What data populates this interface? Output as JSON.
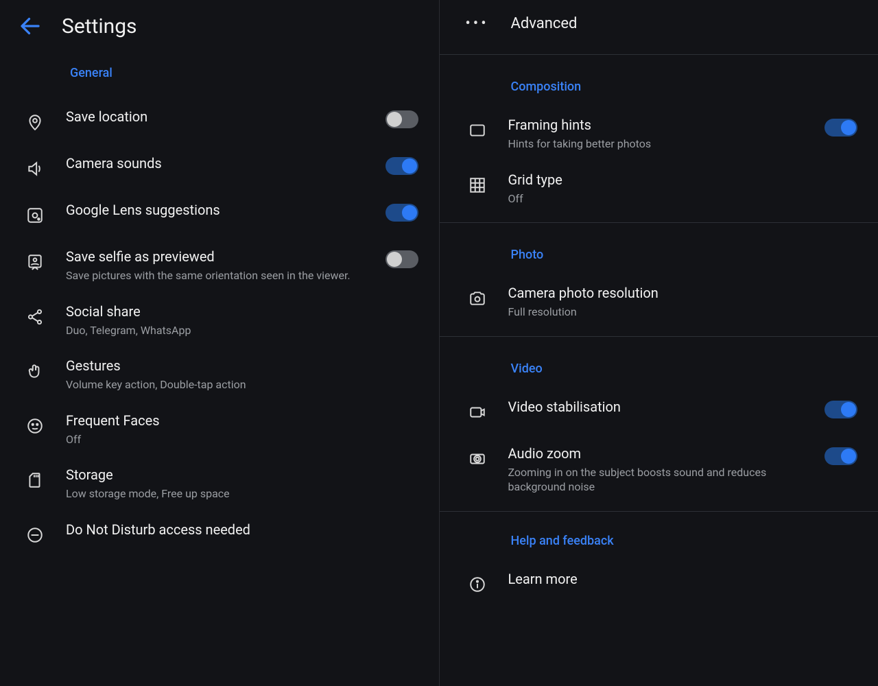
{
  "left": {
    "title": "Settings",
    "section_general": "General",
    "items": {
      "save_location": {
        "label": "Save location"
      },
      "camera_sounds": {
        "label": "Camera sounds"
      },
      "lens": {
        "label": "Google Lens suggestions"
      },
      "selfie": {
        "label": "Save selfie as previewed",
        "sub": "Save pictures with the same orientation seen in the viewer."
      },
      "social": {
        "label": "Social share",
        "sub": "Duo, Telegram, WhatsApp"
      },
      "gestures": {
        "label": "Gestures",
        "sub": "Volume key action, Double-tap action"
      },
      "faces": {
        "label": "Frequent Faces",
        "sub": "Off"
      },
      "storage": {
        "label": "Storage",
        "sub": "Low storage mode, Free up space"
      },
      "dnd": {
        "label": "Do Not Disturb access needed"
      }
    }
  },
  "right": {
    "advanced": "Advanced",
    "section_composition": "Composition",
    "section_photo": "Photo",
    "section_video": "Video",
    "help_header": "Help and feedback",
    "items": {
      "framing": {
        "label": "Framing hints",
        "sub": "Hints for taking better photos"
      },
      "grid": {
        "label": "Grid type",
        "sub": "Off"
      },
      "photo_res": {
        "label": "Camera photo resolution",
        "sub": "Full resolution"
      },
      "vstab": {
        "label": "Video stabilisation"
      },
      "audio_zoom": {
        "label": "Audio zoom",
        "sub": "Zooming in on the subject boosts sound and reduces background noise"
      },
      "learn_more": {
        "label": "Learn more"
      }
    }
  }
}
